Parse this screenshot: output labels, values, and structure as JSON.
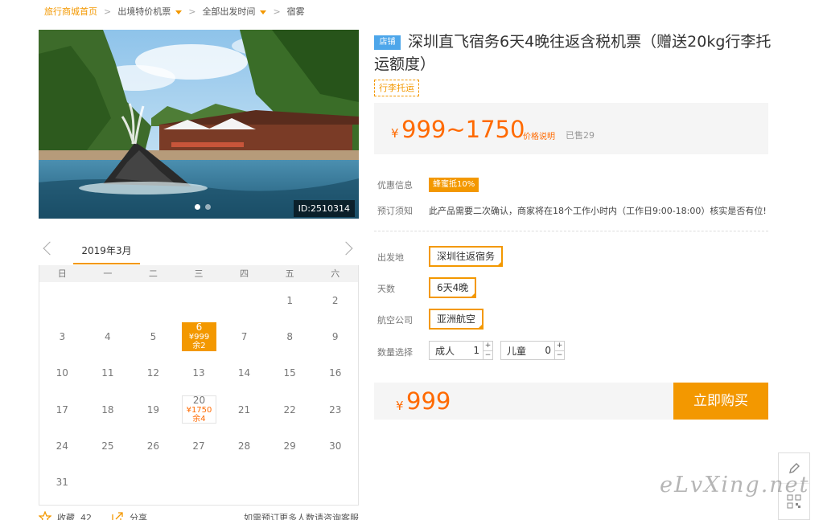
{
  "breadcrumb": {
    "home": "旅行商城首页",
    "category": "出境特价机票",
    "time": "全部出发时间",
    "current": "宿雾"
  },
  "gallery": {
    "id_label": "ID:2510314",
    "slide_count": 2,
    "active_slide": 1
  },
  "calendar": {
    "month_label": "2019年3月",
    "weekdays": [
      "日",
      "一",
      "二",
      "三",
      "四",
      "五",
      "六"
    ],
    "leading_blank_days": 5,
    "days_in_month": 31,
    "special_days": [
      {
        "day": "6",
        "price": "¥999",
        "stock": "余2",
        "state": "selected"
      },
      {
        "day": "20",
        "price": "¥1750",
        "stock": "余4",
        "state": "available"
      }
    ]
  },
  "footer": {
    "favorite_label": "收藏",
    "favorite_count": "42",
    "share_label": "分享",
    "tip": "如需预订更多人数请咨询客服"
  },
  "product": {
    "tag": "店铺",
    "title": "深圳直飞宿务6天4晚往返含税机票（赠送20kg行李托运额度）",
    "feature_tag": "行李托运",
    "currency": "¥",
    "price_range": "999~1750",
    "price_note": "价格说明",
    "sold": "已售29",
    "promo_label": "优惠信息",
    "promo_badge": "蜂蜜抵10%",
    "notice_label": "预订须知",
    "notice_text": "此产品需要二次确认，商家将在18个工作小时内（工作日9:00-18:00）核实是否有位!"
  },
  "options": {
    "departure_label": "出发地",
    "departure_value": "深圳往返宿务",
    "days_label": "天数",
    "days_value": "6天4晚",
    "airline_label": "航空公司",
    "airline_value": "亚洲航空",
    "quantity_label": "数量选择",
    "adult_label": "成人",
    "adult_count": "1",
    "child_label": "儿童",
    "child_count": "0",
    "plus": "+",
    "minus": "−"
  },
  "checkout": {
    "currency": "¥",
    "total": "999",
    "buy_label": "立即购买"
  },
  "watermark": "eLvXing.net",
  "colors": {
    "accent": "#f39800",
    "price": "#ff6a00",
    "store_tag": "#4da6ea"
  }
}
